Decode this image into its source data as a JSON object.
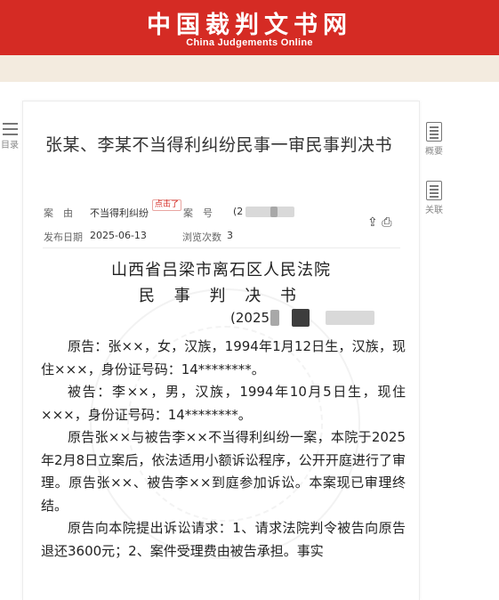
{
  "site": {
    "title_cn": "中国裁判文书网",
    "title_en": "China Judgements Online"
  },
  "side_left": {
    "label": "目录"
  },
  "side_right": [
    {
      "label": "概要",
      "icon": "summary-doc-icon"
    },
    {
      "label": "关联",
      "icon": "related-doc-icon"
    }
  ],
  "document": {
    "title": "张某、李某不当得利纠纷民事一审民事判决书",
    "meta": {
      "cause_label": "案　由",
      "cause_value": "不当得利纠纷",
      "click_tag": "点击了",
      "case_no_label": "案　号",
      "case_no_value": "(2",
      "publish_label": "发布日期",
      "publish_value": "2025-06-13",
      "views_label": "浏览次数",
      "views_value": "3"
    },
    "court_name": "山西省吕梁市离石区人民法院",
    "doc_type": "民 事 判 决 书",
    "case_no_partial": "(2025",
    "paragraphs": [
      "原告：张××，女，汉族，1994年1月12日生，汉族，现住×××，身份证号码：14********。",
      "被告：李××，男，汉族，1994年10月5日生，现住×××，身份证号码：14********。",
      "原告张××与被告李××不当得利纠纷一案，本院于2025年2月8日立案后，依法适用小额诉讼程序，公开开庭进行了审理。原告张××、被告李××到庭参加诉讼。本案现已审理终结。",
      "原告向本院提出诉讼请求：1、请求法院判令被告向原告退还3600元；2、案件受理费由被告承担。事实"
    ]
  },
  "colors": {
    "brand_red": "#d52b24",
    "beige": "#f3ebdf"
  }
}
